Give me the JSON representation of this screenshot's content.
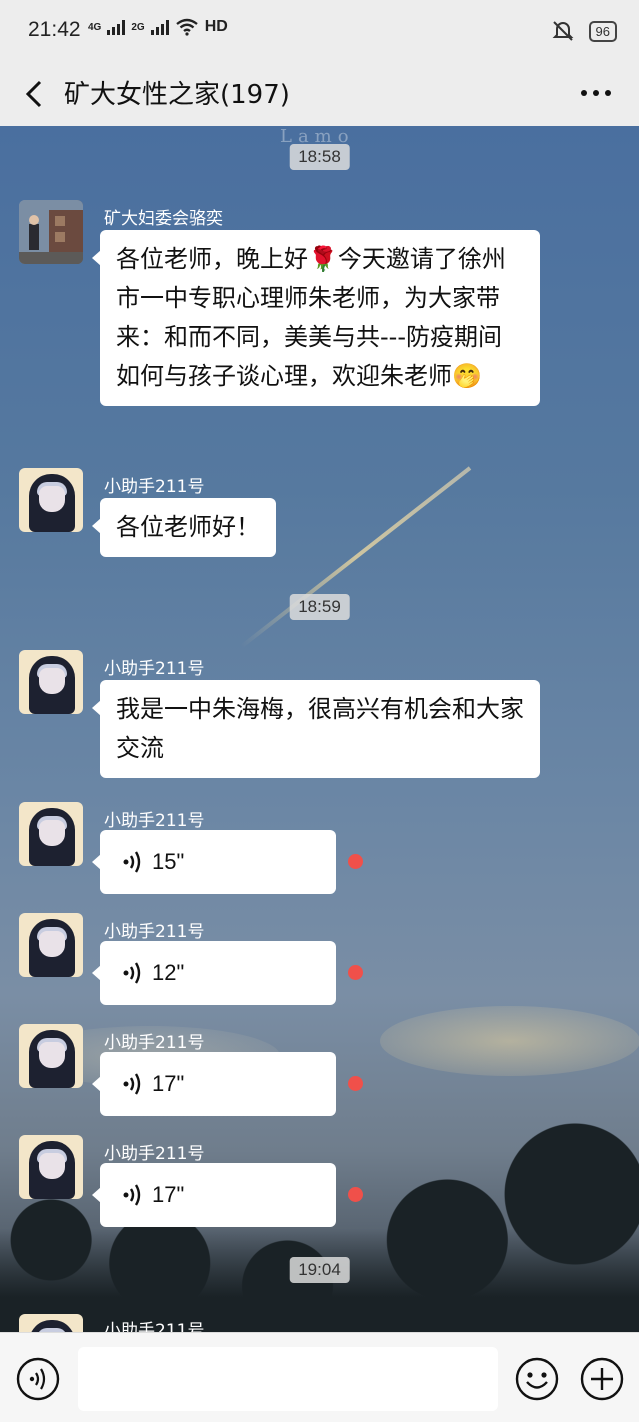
{
  "status_bar": {
    "time": "21:42",
    "net1": "4G",
    "net2": "2G",
    "hd": "HD",
    "battery": "96"
  },
  "header": {
    "title": "矿大女性之家(197)"
  },
  "chat": {
    "watermark": "Lamo",
    "timestamps": [
      "18:58",
      "18:59",
      "19:04"
    ],
    "messages": [
      {
        "sender": "矿大妇委会骆奕",
        "text": "各位老师，晚上好🌹今天邀请了徐州市一中专职心理师朱老师，为大家带来：和而不同，美美与共---防疫期间如何与孩子谈心理，欢迎朱老师🤭"
      },
      {
        "sender": "小助手211号",
        "text": "各位老师好！"
      },
      {
        "sender": "小助手211号",
        "text": "我是一中朱海梅，很高兴有机会和大家交流"
      },
      {
        "sender": "小助手211号",
        "duration": "15\""
      },
      {
        "sender": "小助手211号",
        "duration": "12\""
      },
      {
        "sender": "小助手211号",
        "duration": "17\""
      },
      {
        "sender": "小助手211号",
        "duration": "17\""
      },
      {
        "sender": "小助手211号"
      }
    ]
  },
  "colors": {
    "bubble": "#ffffff",
    "unread_dot": "#f0504a",
    "bar_bg": "#ededed"
  },
  "icons": {
    "back": "chevron-left-icon",
    "more": "more-dots-icon",
    "voice": "voice-wave-icon",
    "emoji": "emoji-icon",
    "plus": "plus-icon"
  }
}
